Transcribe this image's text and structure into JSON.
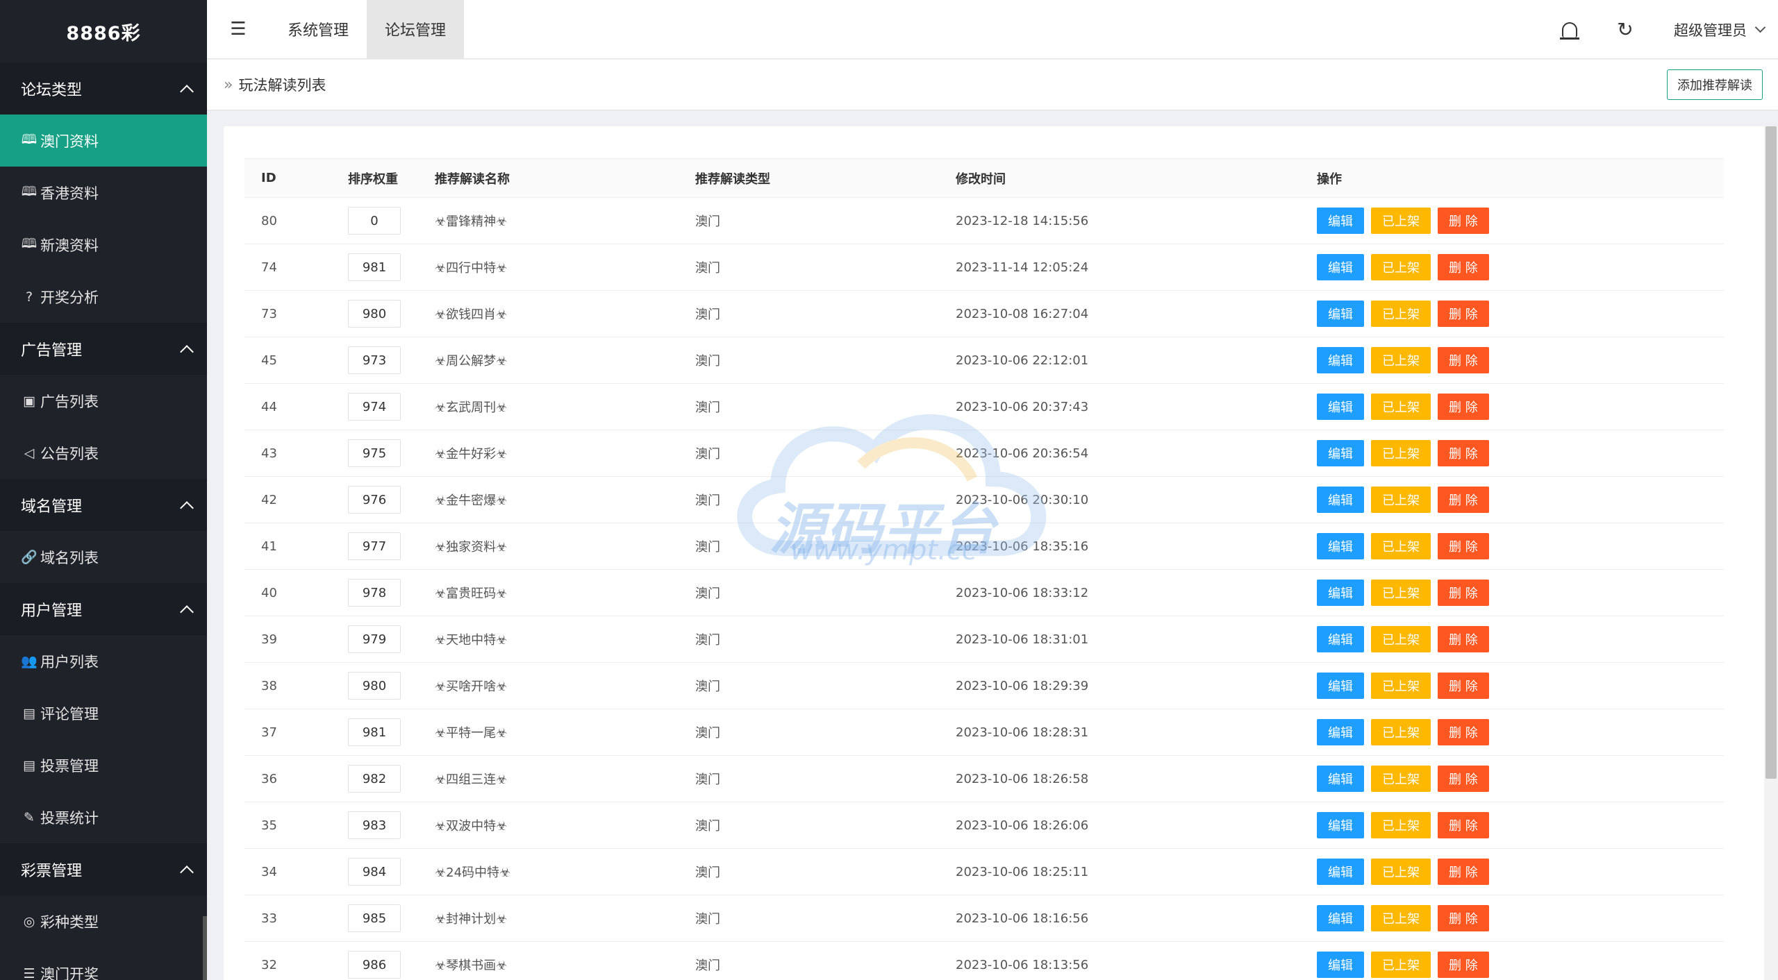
{
  "sidebar": {
    "logo": "8886彩",
    "groups": [
      {
        "title": "论坛类型",
        "items": [
          {
            "label": "澳门资料",
            "icon": "book-icon",
            "glyph": "🕮",
            "active": true
          },
          {
            "label": "香港资料",
            "icon": "book-icon",
            "glyph": "🕮"
          },
          {
            "label": "新澳资料",
            "icon": "book-icon",
            "glyph": "🕮"
          },
          {
            "label": "开奖分析",
            "icon": "question-circle-icon",
            "glyph": "?"
          }
        ]
      },
      {
        "title": "广告管理",
        "items": [
          {
            "label": "广告列表",
            "icon": "image-icon",
            "glyph": "▣"
          },
          {
            "label": "公告列表",
            "icon": "speaker-icon",
            "glyph": "◁"
          }
        ]
      },
      {
        "title": "域名管理",
        "items": [
          {
            "label": "域名列表",
            "icon": "link-icon",
            "glyph": "🔗"
          }
        ]
      },
      {
        "title": "用户管理",
        "items": [
          {
            "label": "用户列表",
            "icon": "users-icon",
            "glyph": "👥"
          },
          {
            "label": "评论管理",
            "icon": "file-icon",
            "glyph": "▤"
          },
          {
            "label": "投票管理",
            "icon": "file-icon",
            "glyph": "▤"
          },
          {
            "label": "投票统计",
            "icon": "edit-icon",
            "glyph": "✎"
          }
        ]
      },
      {
        "title": "彩票管理",
        "items": [
          {
            "label": "彩种类型",
            "icon": "palette-icon",
            "glyph": "◎"
          },
          {
            "label": "澳门开奖",
            "icon": "list-icon",
            "glyph": "☰"
          }
        ]
      }
    ]
  },
  "topbar": {
    "tabs": [
      {
        "label": "系统管理",
        "active": false
      },
      {
        "label": "论坛管理",
        "active": true
      }
    ],
    "user": "超级管理员"
  },
  "breadcrumb": {
    "current": "玩法解读列表"
  },
  "add_button": "添加推荐解读",
  "table": {
    "headers": [
      "ID",
      "排序权重",
      "推荐解读名称",
      "推荐解读类型",
      "修改时间",
      "操作"
    ],
    "actions": {
      "edit": "编辑",
      "onshelf": "已上架",
      "delete": "删 除"
    },
    "rows": [
      {
        "id": "80",
        "weight": "0",
        "name": "☣雷锋精神☣",
        "type": "澳门",
        "time": "2023-12-18 14:15:56"
      },
      {
        "id": "74",
        "weight": "981",
        "name": "☣四行中特☣",
        "type": "澳门",
        "time": "2023-11-14 12:05:24"
      },
      {
        "id": "73",
        "weight": "980",
        "name": "☣欲钱四肖☣",
        "type": "澳门",
        "time": "2023-10-08 16:27:04"
      },
      {
        "id": "45",
        "weight": "973",
        "name": "☣周公解梦☣",
        "type": "澳门",
        "time": "2023-10-06 22:12:01"
      },
      {
        "id": "44",
        "weight": "974",
        "name": "☣玄武周刊☣",
        "type": "澳门",
        "time": "2023-10-06 20:37:43"
      },
      {
        "id": "43",
        "weight": "975",
        "name": "☣金牛好彩☣",
        "type": "澳门",
        "time": "2023-10-06 20:36:54"
      },
      {
        "id": "42",
        "weight": "976",
        "name": "☣金牛密爆☣",
        "type": "澳门",
        "time": "2023-10-06 20:30:10"
      },
      {
        "id": "41",
        "weight": "977",
        "name": "☣独家资料☣",
        "type": "澳门",
        "time": "2023-10-06 18:35:16"
      },
      {
        "id": "40",
        "weight": "978",
        "name": "☣富贵旺码☣",
        "type": "澳门",
        "time": "2023-10-06 18:33:12"
      },
      {
        "id": "39",
        "weight": "979",
        "name": "☣天地中特☣",
        "type": "澳门",
        "time": "2023-10-06 18:31:01"
      },
      {
        "id": "38",
        "weight": "980",
        "name": "☣买啥开啥☣",
        "type": "澳门",
        "time": "2023-10-06 18:29:39"
      },
      {
        "id": "37",
        "weight": "981",
        "name": "☣平特一尾☣",
        "type": "澳门",
        "time": "2023-10-06 18:28:31"
      },
      {
        "id": "36",
        "weight": "982",
        "name": "☣四组三连☣",
        "type": "澳门",
        "time": "2023-10-06 18:26:58"
      },
      {
        "id": "35",
        "weight": "983",
        "name": "☣双波中特☣",
        "type": "澳门",
        "time": "2023-10-06 18:26:06"
      },
      {
        "id": "34",
        "weight": "984",
        "name": "☣24码中特☣",
        "type": "澳门",
        "time": "2023-10-06 18:25:11"
      },
      {
        "id": "33",
        "weight": "985",
        "name": "☣封神计划☣",
        "type": "澳门",
        "time": "2023-10-06 18:16:56"
      },
      {
        "id": "32",
        "weight": "986",
        "name": "☣琴棋书画☣",
        "type": "澳门",
        "time": "2023-10-06 18:13:56"
      }
    ]
  },
  "watermark": {
    "text": "源码平台",
    "url": "www.ympt.cc"
  },
  "colors": {
    "sidebar_bg": "#20222a",
    "active": "#16a085",
    "edit": "#1e9fff",
    "onshelf": "#ffb800",
    "delete": "#ff5722"
  }
}
